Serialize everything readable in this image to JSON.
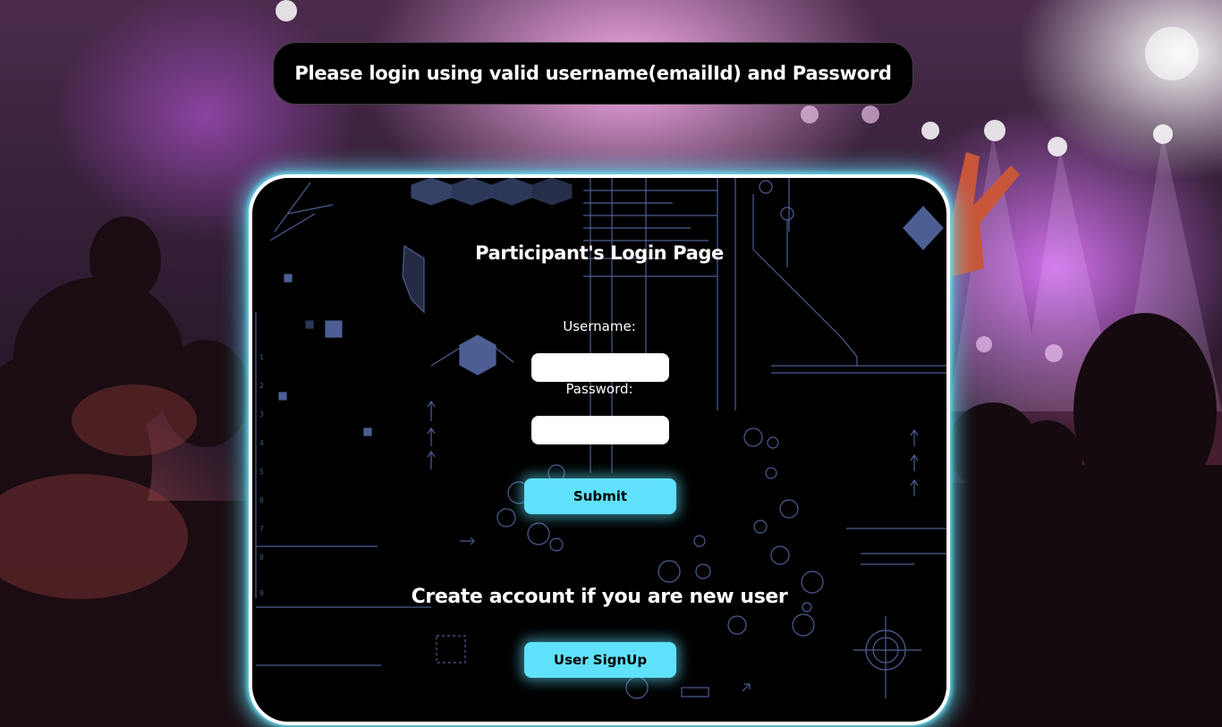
{
  "banner": {
    "message": "Please login using valid username(emailId) and Password"
  },
  "login": {
    "title": "Participant's Login Page",
    "username_label": "Username:",
    "username_value": "",
    "password_label": "Password:",
    "password_value": "",
    "submit_label": "Submit"
  },
  "signup": {
    "heading": "Create account if you are new user",
    "button_label": "User SignUp"
  },
  "colors": {
    "accent": "#5fe1fb",
    "panel_background": "#000000",
    "panel_border": "#ffffff",
    "circuit_lines": "#5b6fae"
  }
}
